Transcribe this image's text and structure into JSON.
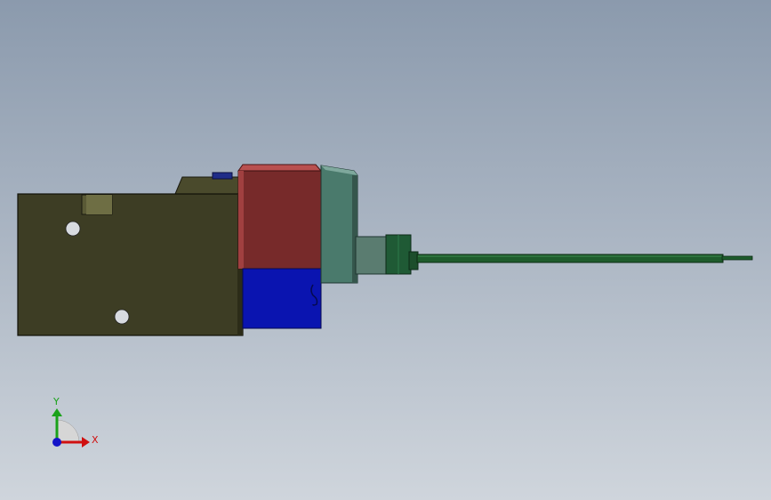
{
  "viewport": {
    "background_top": "#8b9aad",
    "background_bottom": "#cfd5dc"
  },
  "model": {
    "colors": {
      "base_body": "#3d3d24",
      "base_top_block": "#4a4a2c",
      "red_block": "#772a2a",
      "red_block_top": "#b9504f",
      "blue_block": "#0a14b0",
      "teal_block": "#4a7a6c",
      "teal_block_light": "#6e9a8e",
      "gray_connector": "#5a7c70",
      "green_nut": "#1f5a35",
      "probe_rod": "#1e5c2c"
    }
  },
  "triad": {
    "x_label": "X",
    "y_label": "Y",
    "x_color": "#d01010",
    "y_color": "#1aa21a",
    "z_color": "#1414c8"
  }
}
